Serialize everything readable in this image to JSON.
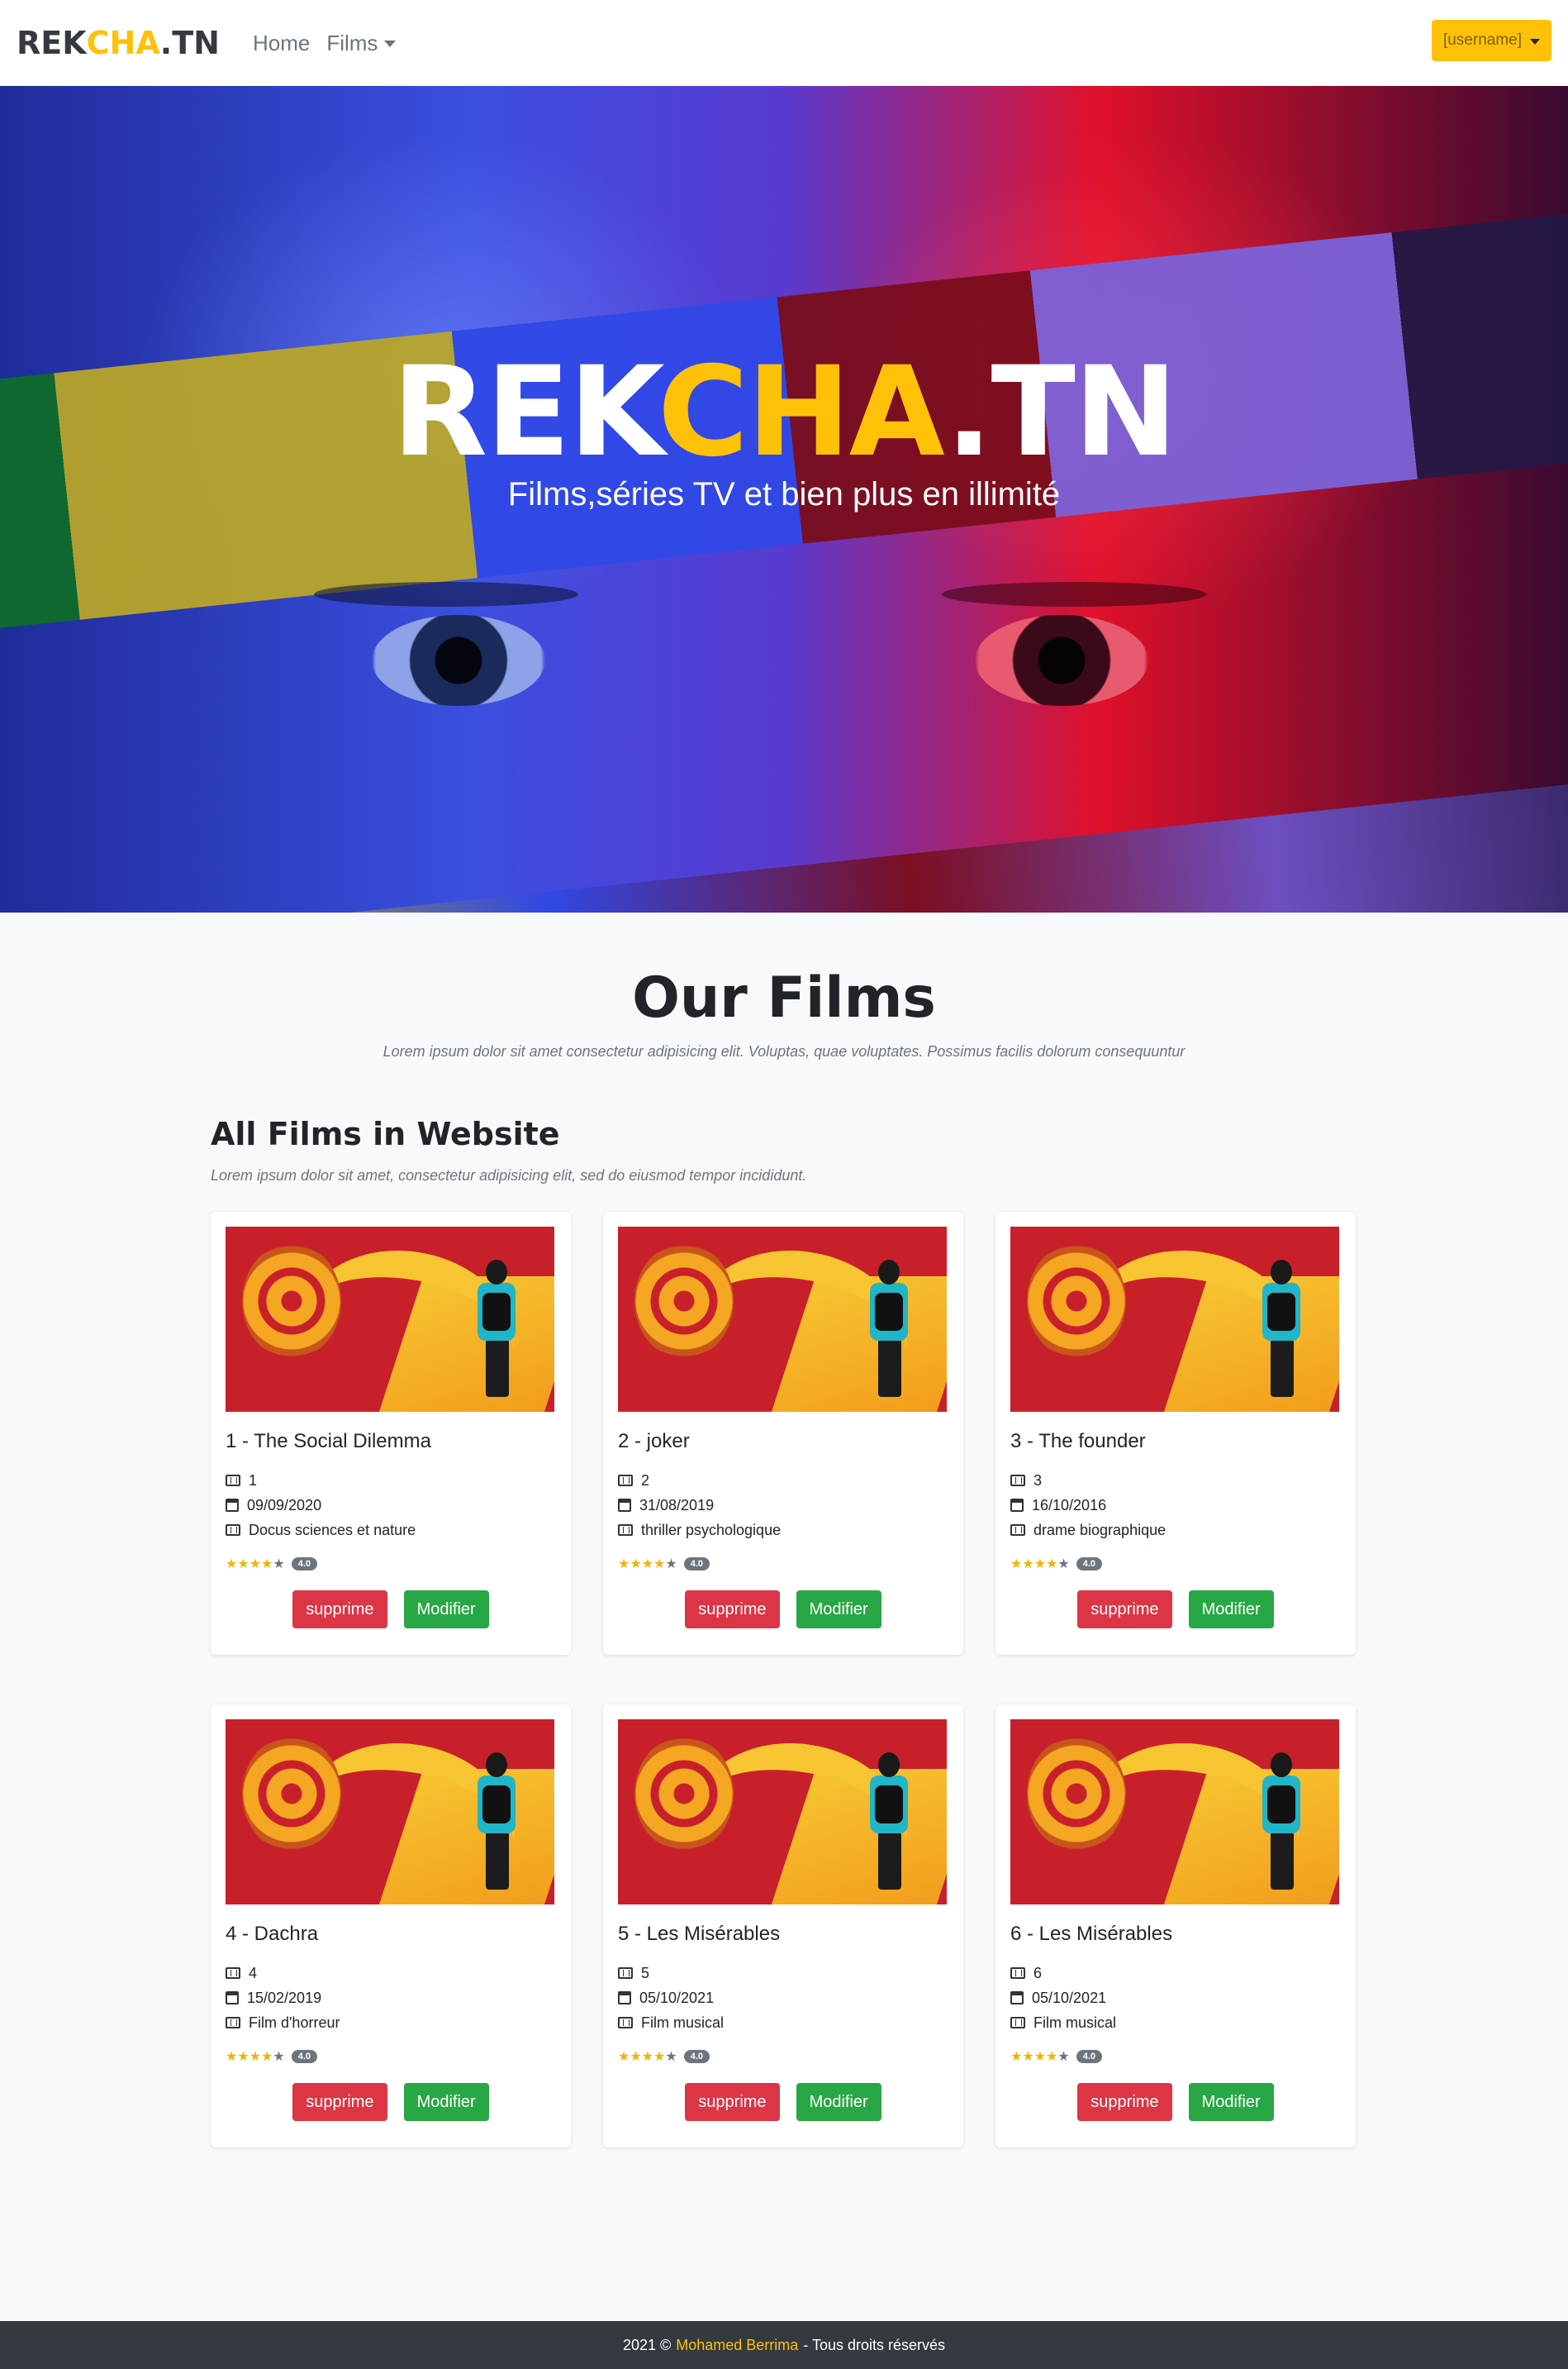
{
  "nav": {
    "brand": {
      "part1": "REK",
      "part2": "CHA",
      "part3": ".TN"
    },
    "links": {
      "home": "Home",
      "films": "Films"
    },
    "user": "[username]"
  },
  "hero": {
    "title": {
      "part1": "REK",
      "part2": "CHA",
      "part3": ".TN"
    },
    "subtitle": "Films,séries TV et bien plus en illimité"
  },
  "main": {
    "title": "Our Films",
    "description": "Lorem ipsum dolor sit amet consectetur adipisicing elit. Voluptas, quae voluptates. Possimus facilis dolorum consequuntur",
    "subtitle": "All Films in Website",
    "subdescription": "Lorem ipsum dolor sit amet, consectetur adipisicing elit, sed do eiusmod tempor incididunt."
  },
  "films": [
    {
      "title": "1 - The Social Dilemma",
      "id": "1",
      "date": "09/09/2020",
      "genre": "Docus sciences et nature",
      "rating": "4.0"
    },
    {
      "title": "2 - joker",
      "id": "2",
      "date": "31/08/2019",
      "genre": "thriller psychologique",
      "rating": "4.0"
    },
    {
      "title": "3 - The founder",
      "id": "3",
      "date": "16/10/2016",
      "genre": "drame biographique",
      "rating": "4.0"
    },
    {
      "title": "4 - Dachra",
      "id": "4",
      "date": "15/02/2019",
      "genre": "Film d'horreur",
      "rating": "4.0"
    },
    {
      "title": "5 - Les Misérables",
      "id": "5",
      "date": "05/10/2021",
      "genre": "Film musical",
      "rating": "4.0"
    },
    {
      "title": "6 - Les Misérables",
      "id": "6",
      "date": "05/10/2021",
      "genre": "Film musical",
      "rating": "4.0"
    }
  ],
  "buttons": {
    "delete": "supprime",
    "edit": "Modifier"
  },
  "footer": {
    "year": "2021 ©",
    "name": "Mohamed Berrima",
    "rights": "- Tous droits réservés"
  },
  "colors": {
    "accent": "#ffc107",
    "danger": "#dc3545",
    "success": "#28a745",
    "dark": "#343a40"
  }
}
